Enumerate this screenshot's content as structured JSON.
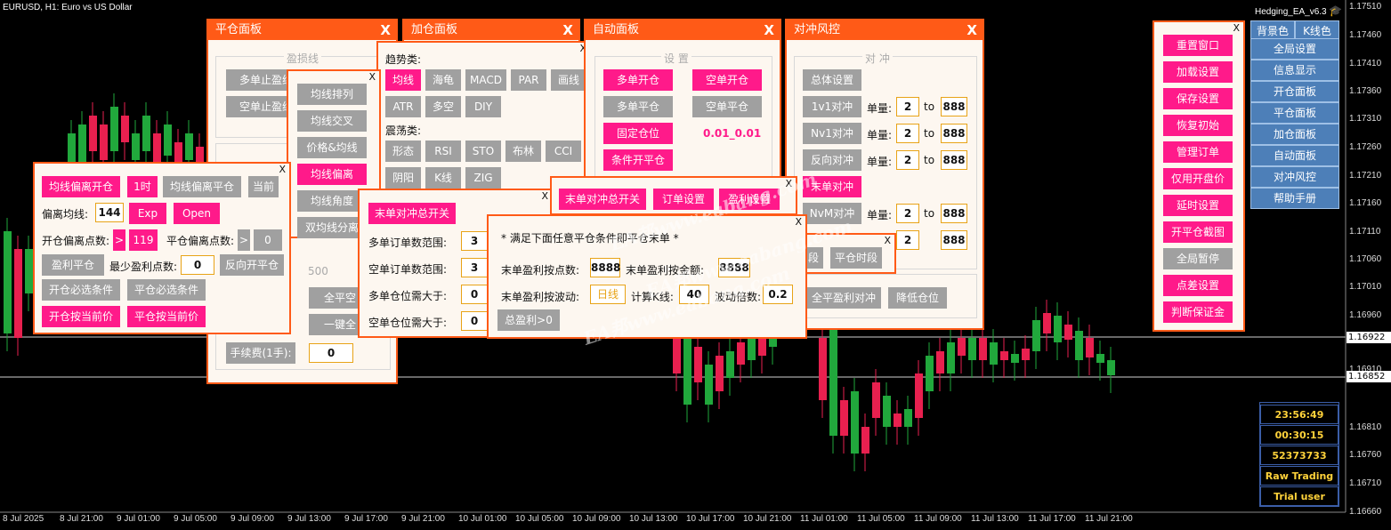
{
  "chart": {
    "symbol_title": "EURUSD, H1:  Euro vs US Dollar",
    "ea_label": "Hedging_EA_v6.3",
    "price_ticks": [
      "1.17510",
      "1.17460",
      "1.17410",
      "1.17360",
      "1.17310",
      "1.17260",
      "1.17210",
      "1.17160",
      "1.17110",
      "1.17060",
      "1.17010",
      "1.16960",
      "1.16910",
      "1.16810",
      "1.16760",
      "1.16710",
      "1.16660"
    ],
    "price_badge_1": "1.16922",
    "price_badge_2": "1.16852",
    "time_ticks": [
      "8 Jul 2025",
      "8 Jul 21:00",
      "9 Jul 01:00",
      "9 Jul 05:00",
      "9 Jul 09:00",
      "9 Jul 13:00",
      "9 Jul 17:00",
      "9 Jul 21:00",
      "10 Jul 01:00",
      "10 Jul 05:00",
      "10 Jul 09:00",
      "10 Jul 13:00",
      "10 Jul 17:00",
      "10 Jul 21:00",
      "11 Jul 01:00",
      "11 Jul 05:00",
      "11 Jul 09:00",
      "11 Jul 13:00",
      "11 Jul 17:00",
      "11 Jul 21:00"
    ],
    "colors": {
      "bull": "#21a83c",
      "bear": "#e8204f",
      "accent": "#ff5a17",
      "pink": "#ff1a8a"
    }
  },
  "watermark": "EA邦www.eabang.com",
  "panel_close": {
    "title": "平仓面板",
    "close": "X",
    "group_title": "盈损线",
    "btn_multi_sl": "多单止盈线",
    "btn_empty_sl": "空单止盈线",
    "val_500": "500",
    "btn_full": "全平空",
    "btn_one": "一键全",
    "fee_label": "手续费(1手):",
    "fee_value": "0"
  },
  "panel_add": {
    "title": "加仓面板",
    "close": "X",
    "trend_label": "趋势类:",
    "trend_btns": [
      "均线",
      "海龟",
      "MACD",
      "PAR",
      "画线",
      "ATR",
      "多空",
      "DIY"
    ],
    "osc_label": "震荡类:",
    "osc_btns": [
      "形态",
      "RSI",
      "STO",
      "布林",
      "CCI",
      "阴阳",
      "K线",
      "ZIG"
    ]
  },
  "panel_auto": {
    "title": "自动面板",
    "close": "X",
    "group_title": "设  置",
    "btn_multi_open": "多单开仓",
    "btn_empty_open": "空单开仓",
    "btn_multi_close": "多单平仓",
    "btn_empty_close": "空单平仓",
    "btn_fixed": "固定仓位",
    "fixed_value": "0.01_0.01",
    "btn_cond": "条件开平仓"
  },
  "panel_hedge": {
    "title": "对冲风控",
    "close": "X",
    "group_title": "对  冲",
    "btn_all": "总体设置",
    "rows": [
      {
        "btn": "1v1对冲",
        "label": "单量:",
        "from": "2",
        "to_label": "to",
        "to": "888"
      },
      {
        "btn": "Nv1对冲",
        "label": "单量:",
        "from": "2",
        "to_label": "to",
        "to": "888"
      },
      {
        "btn": "反向对冲",
        "label": "单量:",
        "from": "2",
        "to_label": "to",
        "to": "888"
      }
    ],
    "btn_tail": "末单对冲",
    "nvm_btn": "NvM对冲",
    "nvm_label": "单量:",
    "nvm_from": "2",
    "nvm_to_label": "to",
    "nvm_to": "888",
    "row5_from": "2",
    "row5_to": "888",
    "btn_full_profit": "全平盈利对冲",
    "btn_reduce": "降低仓位"
  },
  "menu_right": {
    "close": "X",
    "items": [
      "重置窗口",
      "加载设置",
      "保存设置",
      "恢复初始",
      "管理订单",
      "仅用开盘价",
      "延时设置",
      "开平仓截图",
      "全局暂停",
      "点差设置",
      "判断保证金"
    ]
  },
  "side_menu": {
    "top_left": "背景色",
    "top_right": "K线色",
    "items": [
      "全局设置",
      "信息显示",
      "开仓面板",
      "平仓面板",
      "加仓面板",
      "自动面板",
      "对冲风控",
      "帮助手册"
    ]
  },
  "info_box": [
    "23:56:49",
    "00:30:15",
    "52373733",
    "Raw Trading Ltd",
    "Trial user"
  ],
  "popup_ma": {
    "close": "X",
    "items": [
      "均线排列",
      "均线交叉",
      "价格&均线",
      "均线偏离",
      "均线角度",
      "双均线分离"
    ]
  },
  "popup_deviation": {
    "close": "X",
    "btn_open": "均线偏离开仓",
    "btn_1h": "1时",
    "btn_close": "均线偏离平仓",
    "btn_current": "当前",
    "dev_label": "偏离均线:",
    "dev_value": "144",
    "btn_exp": "Exp",
    "btn_open_price": "Open",
    "open_pts_label": "开仓偏离点数:",
    "open_op": ">",
    "open_pts": "119",
    "close_pts_label": "平仓偏离点数:",
    "close_op": ">",
    "close_pts": "0",
    "btn_profit_close": "盈利平仓",
    "min_profit_label": "最少盈利点数:",
    "min_profit": "0",
    "btn_reverse": "反向开平仓",
    "btn_open_cond": "开仓必选条件",
    "btn_close_cond": "平仓必选条件",
    "btn_open_now": "开仓按当前价",
    "btn_close_now": "平仓按当前价"
  },
  "popup_tail_switch": {
    "close": "X",
    "btn": "末单对冲总开关",
    "rows": [
      {
        "label": "多单订单数范围:",
        "value": "3"
      },
      {
        "label": "空单订单数范围:",
        "value": "3"
      },
      {
        "label": "多单仓位需大于:",
        "value": "0"
      },
      {
        "label": "空单仓位需大于:",
        "value": "0"
      }
    ]
  },
  "popup_orders": {
    "close": "X",
    "btn_switch": "末单对冲总开关",
    "btn_order": "订单设置",
    "btn_profit": "盈利设置"
  },
  "popup_profit": {
    "close": "X",
    "title": "* 满足下面任意平仓条件即平仓末单 *",
    "pts_label": "末单盈利按点数:",
    "pts_value": "8888",
    "amt_label": "末单盈利按金额:",
    "amt_value": "8888",
    "wave_label": "末单盈利按波动:",
    "wave_value": "日线",
    "k_label": "计算K线:",
    "k_value": "40",
    "mult_label": "波动倍数:",
    "mult_value": "0.2",
    "btn_total": "总盈利>0"
  },
  "popup_time": {
    "close": "X",
    "btn_seg": "段",
    "btn_time": "平仓时段"
  }
}
